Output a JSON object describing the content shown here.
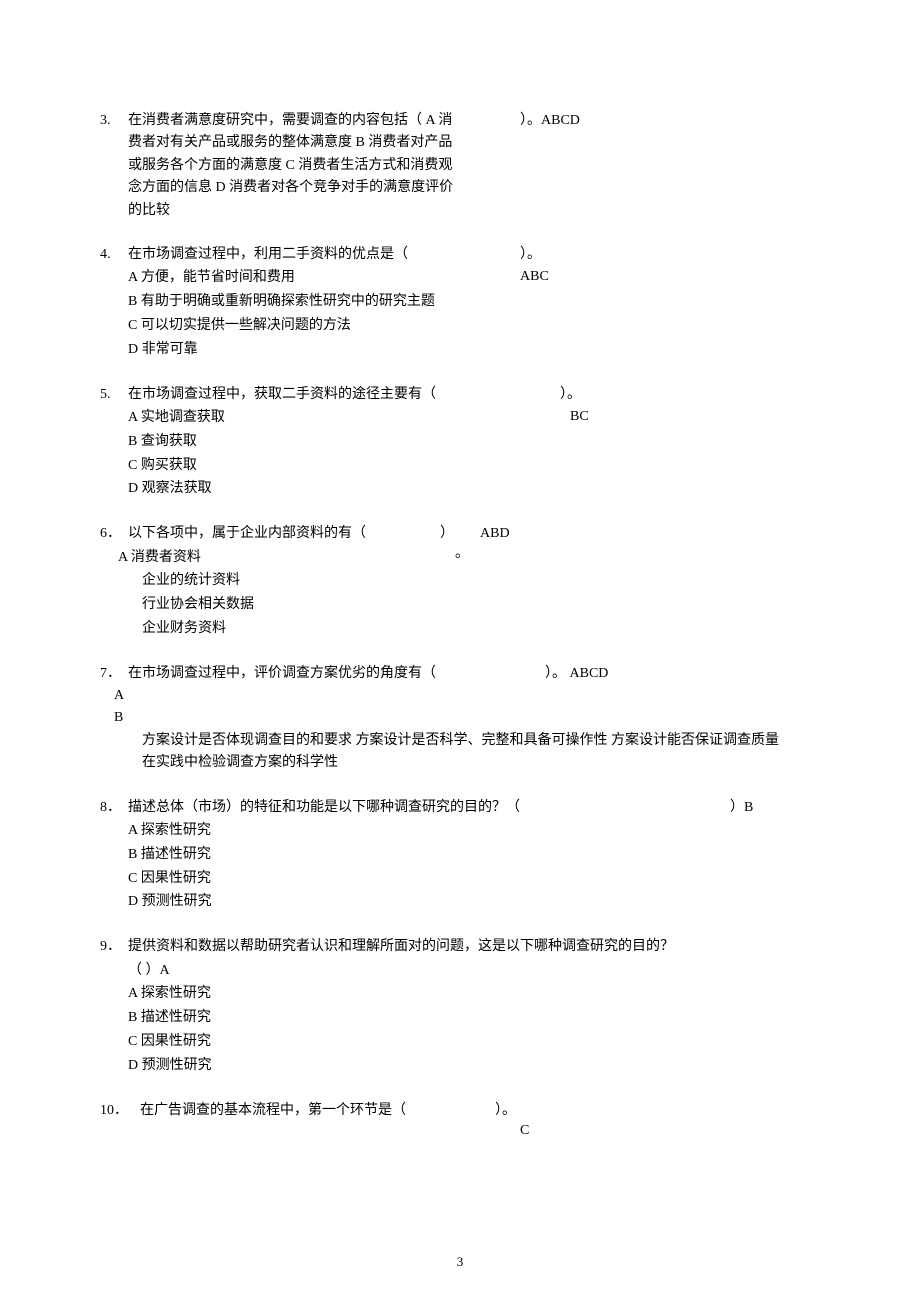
{
  "page_number": "3",
  "q3": {
    "num": "3.",
    "text": "在消费者满意度研究中，需要调查的内容包括（ A 消费者对有关产品或服务的整体满意度 B 消费者对产品或服务各个方面的满意度 C 消费者生活方式和消费观念方面的信息 D 消费者对各个竞争对手的满意度评价的比较",
    "answer": "）。ABCD"
  },
  "q4": {
    "num": "4.",
    "stem": "在市场调查过程中，利用二手资料的优点是（",
    "optA": "A 方便，能节省时间和费用",
    "optB": "B 有助于明确或重新明确探索性研究中的研究主题",
    "optC": "C 可以切实提供一些解决问题的方法",
    "optD": "D 非常可靠",
    "ans1": "）。",
    "ans2": "ABC"
  },
  "q5": {
    "num": "5.",
    "stem": " 在市场调查过程中，获取二手资料的途径主要有（",
    "optA": "A 实地调查获取",
    "optB": "B 查询获取",
    "optC": "C 购买获取",
    "optD": "D 观察法获取",
    "ans1": "）。",
    "ans2": "BC"
  },
  "q6": {
    "num": "6．",
    "stem": "以下各项中，属于企业内部资料的有（",
    "optA": "A  消费者资料",
    "opt2": "企业的统计资料",
    "opt3": "行业协会相关数据",
    "opt4": "企业财务资料",
    "paren": "）",
    "dot": "。",
    "answer": "ABD"
  },
  "q7": {
    "num": "7．",
    "stem": "在市场调查过程中，评价调查方案优劣的角度有（",
    "labA": "A",
    "labB": "B",
    "text": "方案设计是否体现调查目的和要求 方案设计是否科学、完整和具备可操作性 方案设计能否保证调查质量 在实践中检验调查方案的科学性",
    "answer": "）。 ABCD"
  },
  "q8": {
    "num": "8．",
    "stem": "描述总体（市场）的特征和功能是以下哪种调查研究的目的？（",
    "optA": "A 探索性研究",
    "optB": "B 描述性研究",
    "optC": "C 因果性研究",
    "optD": "D 预测性研究",
    "answer": "）B"
  },
  "q9": {
    "num": "9．",
    "stem": "提供资料和数据以帮助研究者认识和理解所面对的问题，这是以下哪种调查研究的目的？",
    "line2": "（            ）A",
    "optA": "A 探索性研究",
    "optB": "B 描述性研究",
    "optC": "C 因果性研究",
    "optD": "D 预测性研究"
  },
  "q10": {
    "num": "10．",
    "stem": "在广告调查的基本流程中，第一个环节是（",
    "ans1": "）。",
    "ans2": "C"
  }
}
